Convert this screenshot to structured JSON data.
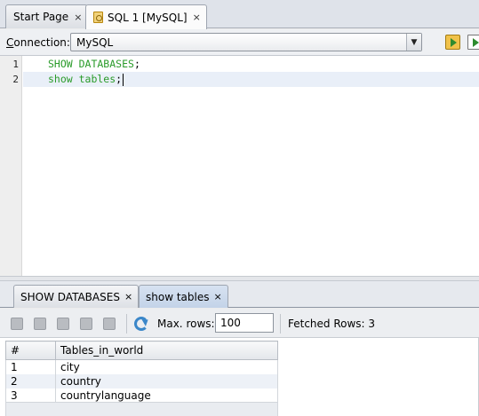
{
  "editor_tabs": [
    {
      "label": "Start Page",
      "close": "×",
      "active": false
    },
    {
      "label": "SQL 1 [MySQL]",
      "close": "×",
      "active": true
    }
  ],
  "connection": {
    "label": "Connection:",
    "label_mnemonic": "C",
    "label_rest": "onnection:",
    "selected": "MySQL",
    "arrow": "▼"
  },
  "toolbar": {
    "icons": [
      "run-sql-icon",
      "run-file-icon"
    ]
  },
  "editor": {
    "line_numbers": [
      "1",
      "2"
    ],
    "lines": [
      {
        "code": "SHOW DATABASES",
        "terminator": ";"
      },
      {
        "code": "show tables",
        "terminator": ";"
      }
    ]
  },
  "output_tabs": [
    {
      "label": "SHOW DATABASES",
      "close": "×",
      "active": false
    },
    {
      "label": "show tables",
      "close": "×",
      "active": true
    }
  ],
  "results_toolbar": {
    "max_rows_label": "Max. rows:",
    "max_rows_value": "100",
    "fetched_rows_label": "Fetched Rows: 3"
  },
  "results_table": {
    "columns": [
      "#",
      "Tables_in_world"
    ],
    "rows": [
      [
        "1",
        "city"
      ],
      [
        "2",
        "country"
      ],
      [
        "3",
        "countrylanguage"
      ]
    ]
  },
  "colors": {
    "keyword": "#2a9b2a",
    "active_output_tab": "#c3d3e8",
    "current_line": "#e9eff8",
    "alt_row": "#edf1f7"
  }
}
